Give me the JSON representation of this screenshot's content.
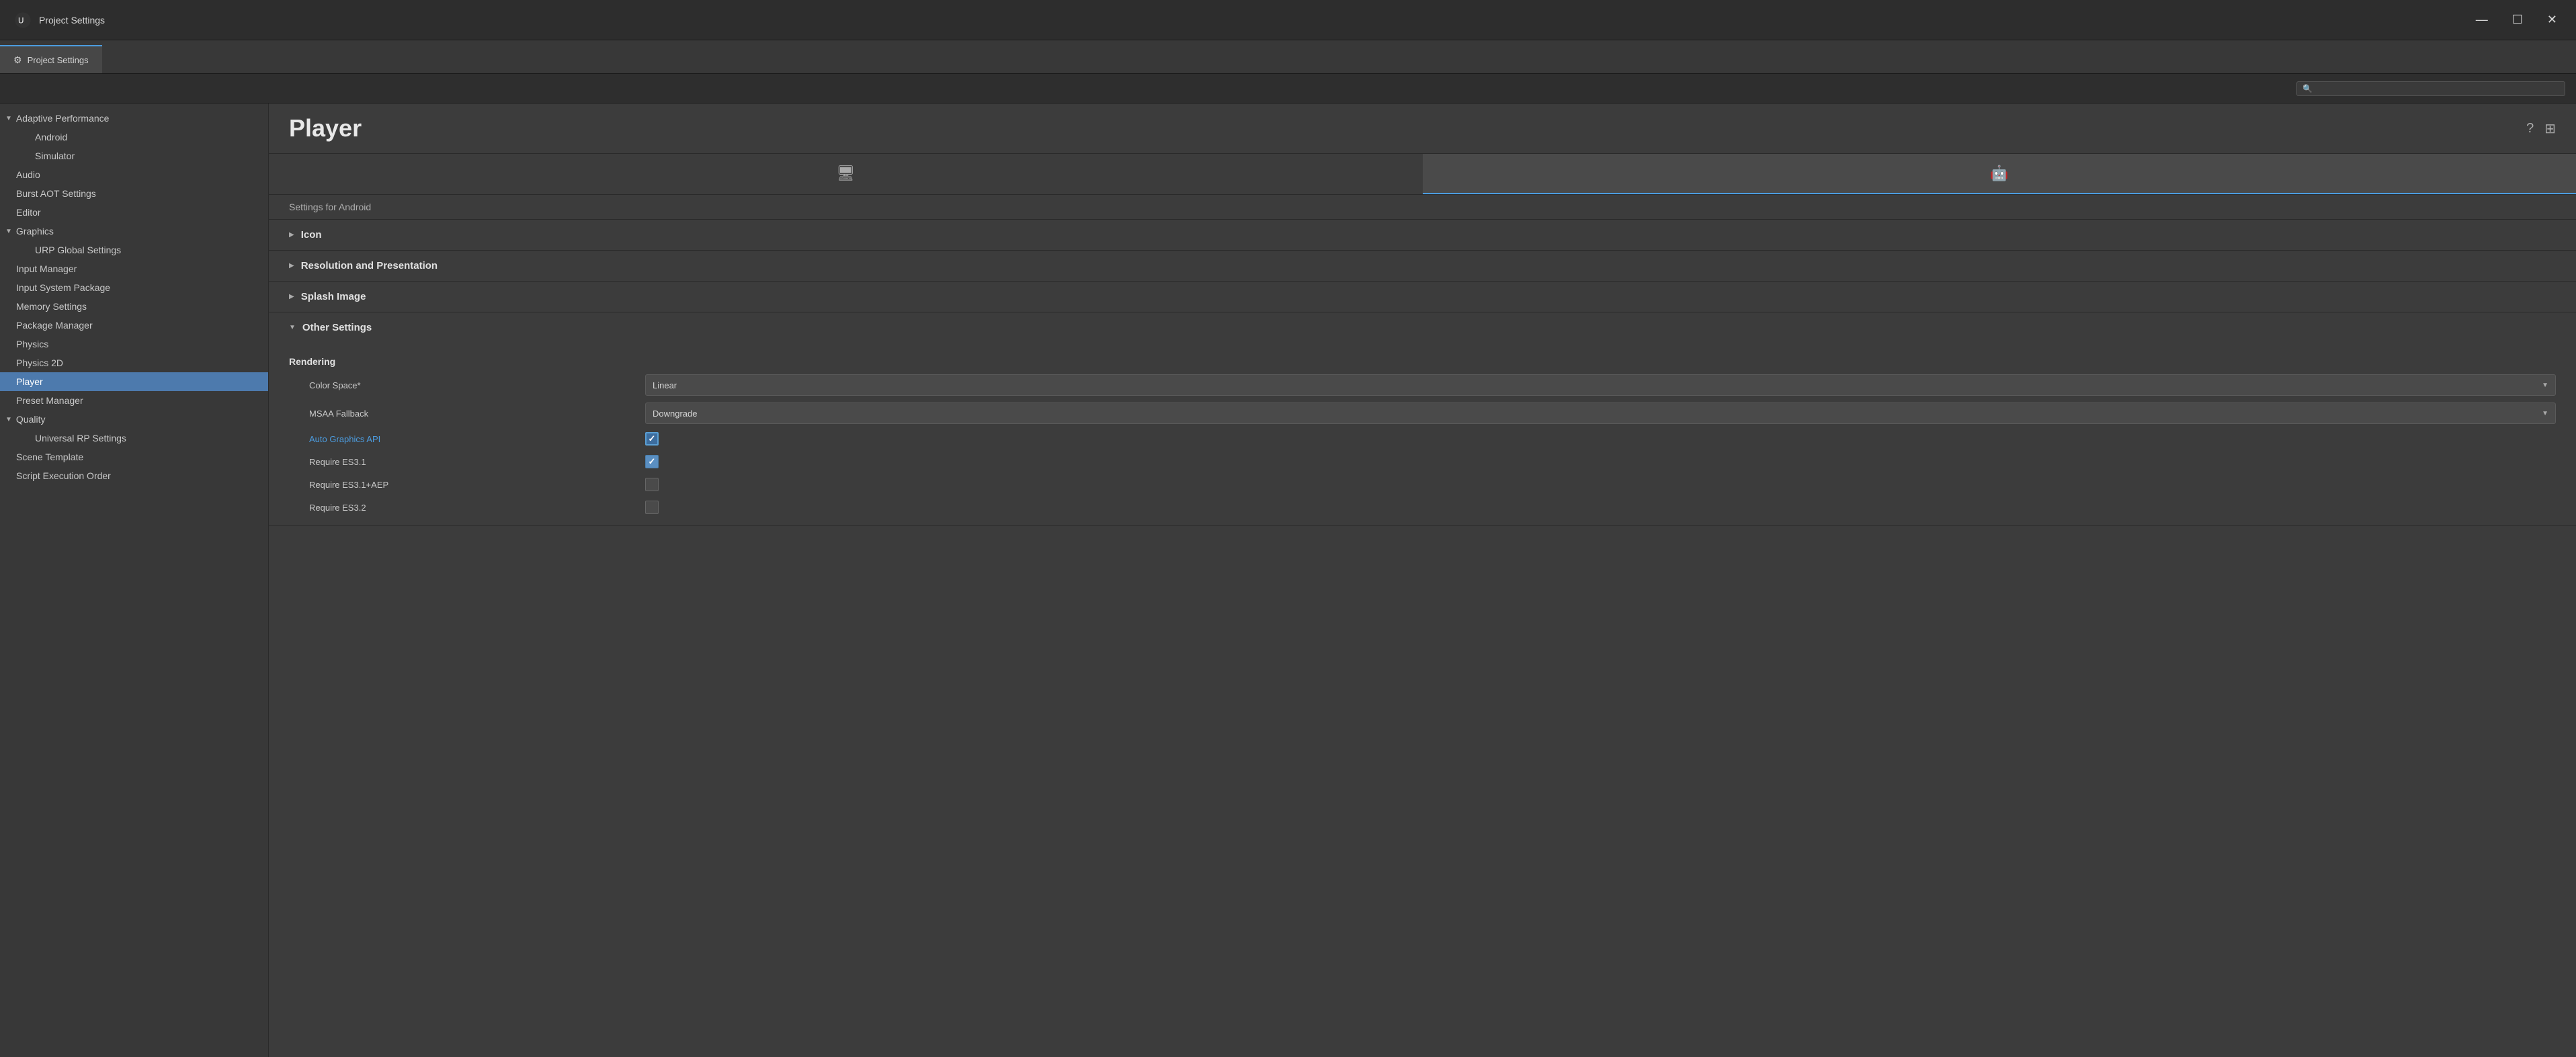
{
  "window": {
    "title": "Project Settings",
    "controls": {
      "minimize": "—",
      "maximize": "☐",
      "close": "✕"
    }
  },
  "tab_bar": {
    "tab": {
      "icon": "⚙",
      "label": "Project Settings"
    }
  },
  "search": {
    "placeholder": ""
  },
  "sidebar": {
    "items": [
      {
        "id": "adaptive-performance",
        "label": "Adaptive Performance",
        "type": "parent",
        "expanded": true,
        "arrow": "▼"
      },
      {
        "id": "android",
        "label": "Android",
        "type": "child"
      },
      {
        "id": "simulator",
        "label": "Simulator",
        "type": "child"
      },
      {
        "id": "audio",
        "label": "Audio",
        "type": "top"
      },
      {
        "id": "burst-aot",
        "label": "Burst AOT Settings",
        "type": "top"
      },
      {
        "id": "editor",
        "label": "Editor",
        "type": "top"
      },
      {
        "id": "graphics",
        "label": "Graphics",
        "type": "parent",
        "expanded": true,
        "arrow": "▼"
      },
      {
        "id": "urp-global",
        "label": "URP Global Settings",
        "type": "child"
      },
      {
        "id": "input-manager",
        "label": "Input Manager",
        "type": "top"
      },
      {
        "id": "input-system",
        "label": "Input System Package",
        "type": "top"
      },
      {
        "id": "memory-settings",
        "label": "Memory Settings",
        "type": "top"
      },
      {
        "id": "package-manager",
        "label": "Package Manager",
        "type": "top"
      },
      {
        "id": "physics",
        "label": "Physics",
        "type": "top"
      },
      {
        "id": "physics-2d",
        "label": "Physics 2D",
        "type": "top"
      },
      {
        "id": "player",
        "label": "Player",
        "type": "top",
        "active": true
      },
      {
        "id": "preset-manager",
        "label": "Preset Manager",
        "type": "top"
      },
      {
        "id": "quality",
        "label": "Quality",
        "type": "parent",
        "expanded": true,
        "arrow": "▼"
      },
      {
        "id": "universal-rp",
        "label": "Universal RP Settings",
        "type": "child"
      },
      {
        "id": "scene-template",
        "label": "Scene Template",
        "type": "top"
      },
      {
        "id": "script-execution",
        "label": "Script Execution Order",
        "type": "top"
      }
    ]
  },
  "content": {
    "title": "Player",
    "platform_tabs": [
      {
        "id": "desktop",
        "icon": "🖥",
        "active": false
      },
      {
        "id": "android",
        "icon": "🤖",
        "active": true
      }
    ],
    "settings_label": "Settings for Android",
    "sections": [
      {
        "id": "icon",
        "title": "Icon",
        "expanded": false,
        "arrow": "▶"
      },
      {
        "id": "resolution",
        "title": "Resolution and Presentation",
        "expanded": false,
        "arrow": "▶"
      },
      {
        "id": "splash",
        "title": "Splash Image",
        "expanded": false,
        "arrow": "▶"
      },
      {
        "id": "other",
        "title": "Other Settings",
        "expanded": true,
        "arrow": "▼",
        "subsections": [
          {
            "id": "rendering",
            "title": "Rendering",
            "fields": [
              {
                "id": "color-space",
                "label": "Color Space*",
                "type": "dropdown",
                "value": "Linear"
              },
              {
                "id": "msaa-fallback",
                "label": "MSAA Fallback",
                "type": "dropdown",
                "value": "Downgrade"
              },
              {
                "id": "auto-graphics-api",
                "label": "Auto Graphics API",
                "type": "checkbox",
                "checked": true,
                "highlight": true,
                "isLink": true
              },
              {
                "id": "require-es31",
                "label": "Require ES3.1",
                "type": "checkbox",
                "checked": true,
                "highlight": false
              },
              {
                "id": "require-es31-aep",
                "label": "Require ES3.1+AEP",
                "type": "checkbox",
                "checked": false,
                "highlight": false
              },
              {
                "id": "require-es32",
                "label": "Require ES3.2",
                "type": "checkbox",
                "checked": false,
                "highlight": false
              }
            ]
          }
        ]
      }
    ]
  }
}
